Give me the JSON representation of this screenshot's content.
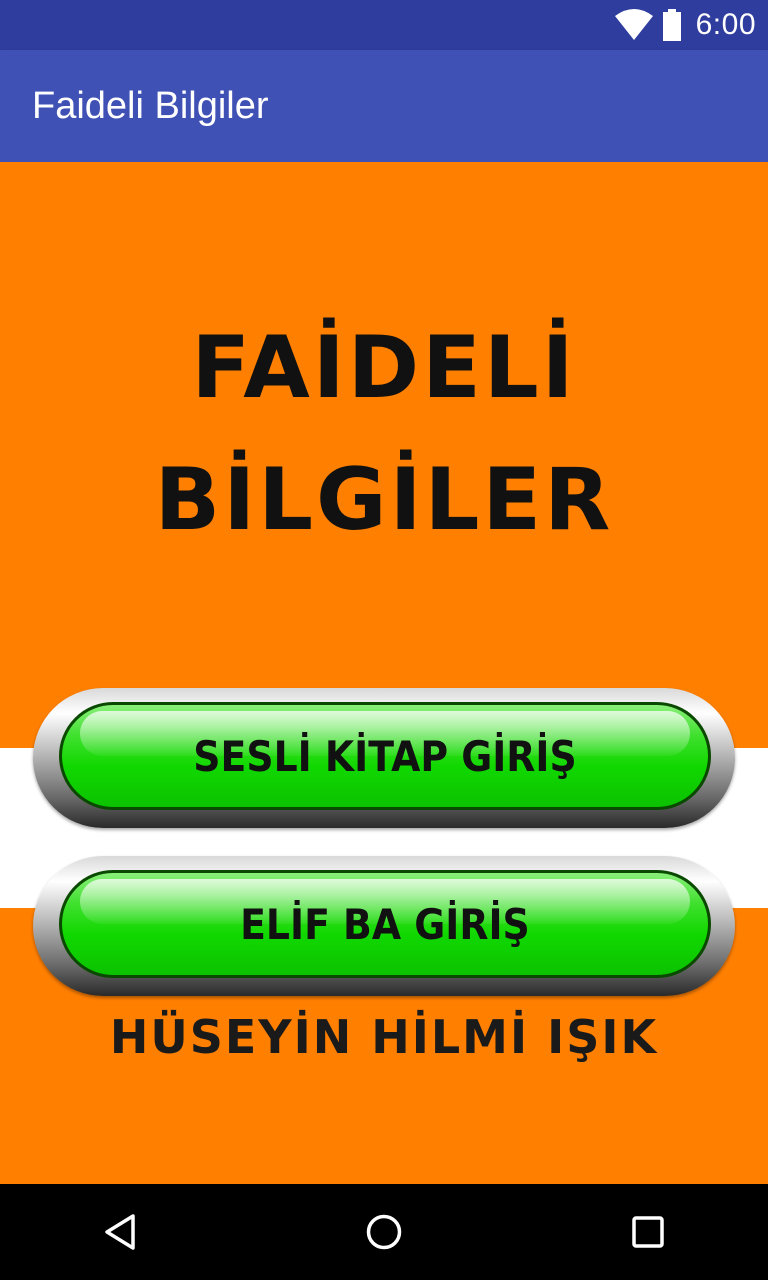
{
  "status_bar": {
    "time": "6:00",
    "icons": [
      "wifi-icon",
      "battery-icon"
    ],
    "color": "#2f3d9e"
  },
  "app_bar": {
    "title": "Faideli Bilgiler",
    "color": "#3f51b5"
  },
  "main": {
    "background_color": "#ff7f00",
    "heading_line1": "FAİDELİ",
    "heading_line2": "BİLGİLER",
    "buttons": [
      {
        "label": "SESLİ KİTAP GİRİŞ"
      },
      {
        "label": "ELİF BA GİRİŞ"
      }
    ],
    "button_color": "#11d800",
    "author": "HÜSEYİN HİLMİ IŞIK"
  },
  "nav_bar": {
    "buttons": [
      "back-icon",
      "home-icon",
      "recent-apps-icon"
    ]
  }
}
